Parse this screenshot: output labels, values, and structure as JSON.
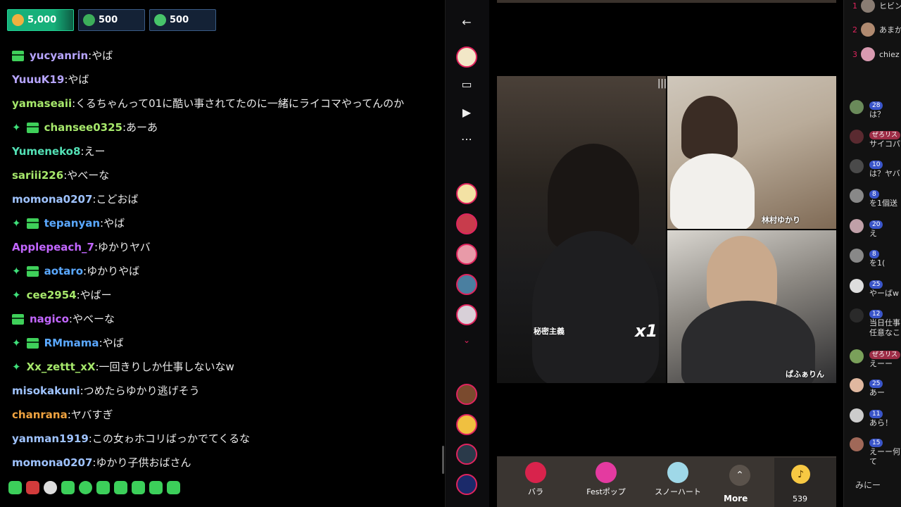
{
  "badges": [
    {
      "value": "5,000",
      "color": "#16b07a"
    },
    {
      "value": "500",
      "color": "#142236"
    },
    {
      "value": "500",
      "color": "#142236"
    }
  ],
  "chat": [
    {
      "user": "yucyanrin",
      "text": "やば",
      "color": "#b7a5ff",
      "sparkle": false,
      "gift": true
    },
    {
      "user": "YuuuK19",
      "text": "やば",
      "color": "#b7a5ff",
      "sparkle": false,
      "gift": false
    },
    {
      "user": "yamaseaii",
      "text": "くるちゃんって01に酷い事されてたのに一緒にライコマやってんのか",
      "color": "#a6e86b",
      "sparkle": false,
      "gift": false
    },
    {
      "user": "chansee0325",
      "text": "あーあ",
      "color": "#a6e86b",
      "sparkle": true,
      "gift": true
    },
    {
      "user": "Yumeneko8",
      "text": "えー",
      "color": "#53e0b5",
      "sparkle": false,
      "gift": false
    },
    {
      "user": "sariii226",
      "text": "やべーな",
      "color": "#a6e86b",
      "sparkle": false,
      "gift": false
    },
    {
      "user": "momona0207",
      "text": "こどおば",
      "color": "#9fc3ff",
      "sparkle": false,
      "gift": false
    },
    {
      "user": "tepanyan",
      "text": "やば",
      "color": "#5aa8ff",
      "sparkle": true,
      "gift": true
    },
    {
      "user": "Applepeach_7",
      "text": "ゆかりヤバ",
      "color": "#c266ff",
      "sparkle": false,
      "gift": false
    },
    {
      "user": "aotaro",
      "text": "ゆかりやば",
      "color": "#5aa8ff",
      "sparkle": true,
      "gift": true
    },
    {
      "user": "cee2954",
      "text": "やばー",
      "color": "#a6e86b",
      "sparkle": true,
      "gift": false
    },
    {
      "user": "nagico",
      "text": "やべーな",
      "color": "#c266ff",
      "sparkle": false,
      "gift": true
    },
    {
      "user": "RMmama",
      "text": "やば",
      "color": "#5aa8ff",
      "sparkle": true,
      "gift": true
    },
    {
      "user": "Xx_zettt_xX",
      "text": "一回きりしか仕事しないなw",
      "color": "#a6e86b",
      "sparkle": true,
      "gift": false
    },
    {
      "user": "misokakuni",
      "text": "つめたらゆかり逃げそう",
      "color": "#9fc3ff",
      "sparkle": false,
      "gift": false
    },
    {
      "user": "chanrana",
      "text": "ヤバすぎ",
      "color": "#f0a340",
      "sparkle": false,
      "gift": false
    },
    {
      "user": "yanman1919",
      "text": "この女ゎホコリばっかでてくるな",
      "color": "#9fc3ff",
      "sparkle": false,
      "gift": false
    },
    {
      "user": "momona0207",
      "text": "ゆかり子供おばさん",
      "color": "#9fc3ff",
      "sparkle": false,
      "gift": false
    }
  ],
  "video": {
    "main_label": "秘密主義",
    "multiplier": "x1",
    "top_right_label": "林村ゆかり",
    "bottom_right_label": "ぱふぁりん"
  },
  "gifts": [
    {
      "label": "バラ",
      "color": "#d8234c"
    },
    {
      "label": "Festポップ",
      "color": "#e43aa0"
    },
    {
      "label": "スノーハート",
      "color": "#9fd8e8"
    }
  ],
  "more_label": "More",
  "coin_count": "539",
  "ranking": [
    {
      "rank": "1",
      "name": "ヒビン"
    },
    {
      "rank": "2",
      "name": "あまか"
    },
    {
      "rank": "3",
      "name": "chiez"
    }
  ],
  "right_comments": [
    {
      "level": "28",
      "text": "は？",
      "red": false
    },
    {
      "level": "ぜろリス",
      "text": "サイコパ",
      "red": true
    },
    {
      "level": "10",
      "text": "は？ヤバ",
      "red": false
    },
    {
      "level": "8",
      "text": "を1個送",
      "red": false
    },
    {
      "level": "20",
      "text": "え",
      "red": false
    },
    {
      "level": "8",
      "text": "を1(",
      "red": false
    },
    {
      "level": "25",
      "text": "やーばw",
      "red": false
    },
    {
      "level": "12",
      "text": "当日仕事 任意なこ",
      "red": false
    },
    {
      "level": "ぜろリス",
      "text": "えーー",
      "red": true
    },
    {
      "level": "25",
      "text": "あー",
      "red": false
    },
    {
      "level": "11",
      "text": "あら！",
      "red": false
    },
    {
      "level": "15",
      "text": "えーー何 て",
      "red": false
    }
  ],
  "right_footer": "みにー"
}
